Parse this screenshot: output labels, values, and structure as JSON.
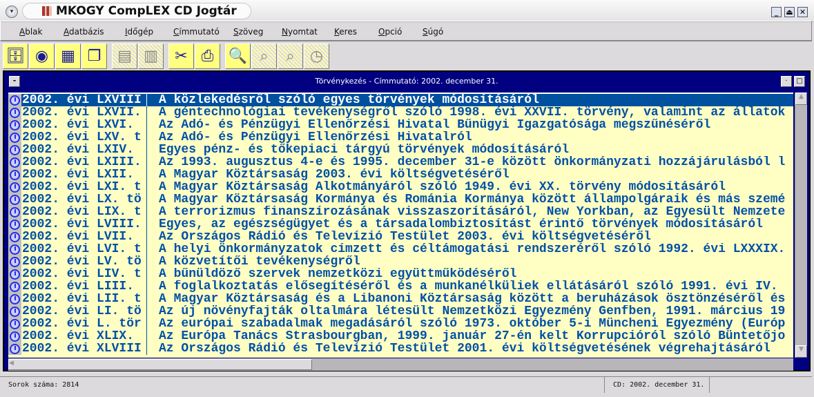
{
  "window": {
    "title": "MKOGY CompLEX CD Jogtár",
    "buttons": [
      "minimize",
      "maximize",
      "close"
    ]
  },
  "menu": [
    {
      "label": "Ablak"
    },
    {
      "label": "Adatbázis"
    },
    {
      "label": "Időgép"
    },
    {
      "label": "Címmutató"
    },
    {
      "label": "Szöveg"
    },
    {
      "label": "Nyomtat"
    },
    {
      "label": "Keres"
    },
    {
      "label": "Opció"
    },
    {
      "label": "Súgó"
    }
  ],
  "toolbar": [
    {
      "icon": "database-icon"
    },
    {
      "icon": "compass-icon"
    },
    {
      "icon": "tile-windows-icon"
    },
    {
      "icon": "cascade-windows-icon"
    },
    {
      "icon": "document-icon",
      "disabled": true
    },
    {
      "icon": "page-icon",
      "disabled": true
    },
    {
      "icon": "scissors-icon"
    },
    {
      "icon": "printer-icon"
    },
    {
      "icon": "magnifier-icon"
    },
    {
      "icon": "search-next-icon",
      "disabled": true
    },
    {
      "icon": "search-prev-icon",
      "disabled": true
    },
    {
      "icon": "clock-icon",
      "disabled": true
    }
  ],
  "child_window": {
    "title": "Törvénykezés - Címmutató: 2002. december 31."
  },
  "rows": [
    {
      "id": "2002. évi LXVIII",
      "title": "A közlekedésről szóló egyes törvények módosításáról",
      "selected": true
    },
    {
      "id": "2002. évi LXVII.",
      "title": "A géntechnológiai tevékenységről szóló 1998. évi XXVII. törvény, valamint az állatok"
    },
    {
      "id": "2002. évi LXVI.",
      "title": "Az Adó- és Pénzügyi Ellenőrzési Hivatal Bűnügyi Igazgatósága megszűnéséről"
    },
    {
      "id": "2002. évi LXV. t",
      "title": "Az Adó- és Pénzügyi Ellenőrzési Hivatalról"
    },
    {
      "id": "2002. évi LXIV.",
      "title": "Egyes pénz- és tőkepiaci tárgyú törvények módosításáról"
    },
    {
      "id": "2002. évi LXIII.",
      "title": "Az 1993. augusztus 4-e és 1995. december 31-e között önkormányzati hozzájárulásból l"
    },
    {
      "id": "2002. évi LXII.",
      "title": "A Magyar Köztársaság 2003. évi költségvetéséről"
    },
    {
      "id": "2002. évi LXI. t",
      "title": "A Magyar Köztársaság Alkotmányáról szóló 1949. évi XX. törvény módosításáról"
    },
    {
      "id": "2002. évi LX. tö",
      "title": "A Magyar Köztársaság Kormánya és Románia Kormánya között állampolgáraik és más szemé"
    },
    {
      "id": "2002. évi LIX. t",
      "title": "A terrorizmus finanszírozásának visszaszorításáról, New Yorkban, az Egyesült Nemzete"
    },
    {
      "id": "2002. évi LVIII.",
      "title": "Egyes, az egészségügyet és a társadalombiztosítást érintő törvények módosításáról"
    },
    {
      "id": "2002. évi LVII.",
      "title": "Az Országos Rádió és Televízió Testület 2003. évi költségvetéséről"
    },
    {
      "id": "2002. évi LVI. t",
      "title": "A helyi önkormányzatok címzett és céltámogatási rendszeréről szóló 1992. évi LXXXIX."
    },
    {
      "id": "2002. évi LV. tö",
      "title": "A közvetítői tevékenységről"
    },
    {
      "id": "2002. évi LIV. t",
      "title": "A bűnüldöző szervek nemzetközi együttműködéséről"
    },
    {
      "id": "2002. évi LIII.",
      "title": "A foglalkoztatás elősegítéséről és a munkanélküliek ellátásáról szóló 1991. évi IV."
    },
    {
      "id": "2002. évi LII. t",
      "title": "A Magyar Köztársaság és a Libanoni Köztársaság között a beruházások ösztönzéséről és"
    },
    {
      "id": "2002. évi LI. tö",
      "title": "Az új növényfajták oltalmára létesült Nemzetközi Egyezmény Genfben, 1991. március 19"
    },
    {
      "id": "2002. évi L. tör",
      "title": "Az európai szabadalmak megadásáról szóló 1973. október 5-i Müncheni Egyezmény (Európ"
    },
    {
      "id": "2002. évi XLIX.",
      "title": "Az Európa Tanács Strasbourgban, 1999. január 27-én kelt Korrupcióról szóló Büntetőjo"
    },
    {
      "id": "2002. évi XLVIII",
      "title": "Az Országos Rádió és Televízió Testület 2001. évi költségvetésének végrehajtásáról"
    }
  ],
  "status": {
    "rows": "Sorok száma: 2814",
    "cd": "CD: 2002. december 31."
  }
}
